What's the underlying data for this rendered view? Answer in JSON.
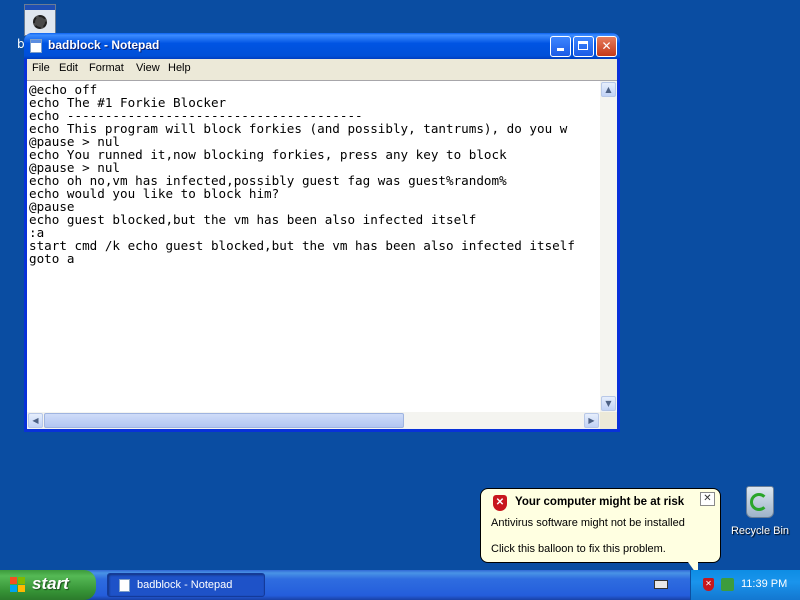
{
  "desktop": {
    "top_icon_partial_label": "b",
    "recycle_bin_label": "Recycle Bin"
  },
  "window": {
    "title": "badblock - Notepad",
    "minimize_glyph": "",
    "close_glyph": "✕",
    "menu": [
      "File",
      "Edit",
      "Format",
      "View",
      "Help"
    ],
    "content_lines": [
      "@echo off",
      "echo The #1 Forkie Blocker",
      "echo ---------------------------------------",
      "echo This program will block forkies (and possibly, tantrums), do you w",
      "@pause > nul",
      "echo You runned it,now blocking forkies, press any key to block",
      "@pause > nul",
      "echo oh no,vm has infected,possibly guest fag was guest%random%",
      "echo would you like to block him?",
      "@pause",
      "echo guest blocked,but the vm has been also infected itself",
      ":a",
      "start cmd /k echo guest blocked,but the vm has been also infected itself",
      "goto a"
    ]
  },
  "balloon": {
    "title": "Your computer might be at risk",
    "line1": "Antivirus software might not be installed",
    "line2": "Click this balloon to fix this problem.",
    "close_glyph": "✕",
    "icon": "security-shield-icon"
  },
  "taskbar": {
    "start_label": "start",
    "task_label": "badblock - Notepad",
    "clock": "11:39 PM"
  },
  "colors": {
    "desktop": "#0a4da2",
    "titlebar": "#0054e3",
    "balloon_bg": "#ffffe1",
    "start_button": "#369336"
  }
}
